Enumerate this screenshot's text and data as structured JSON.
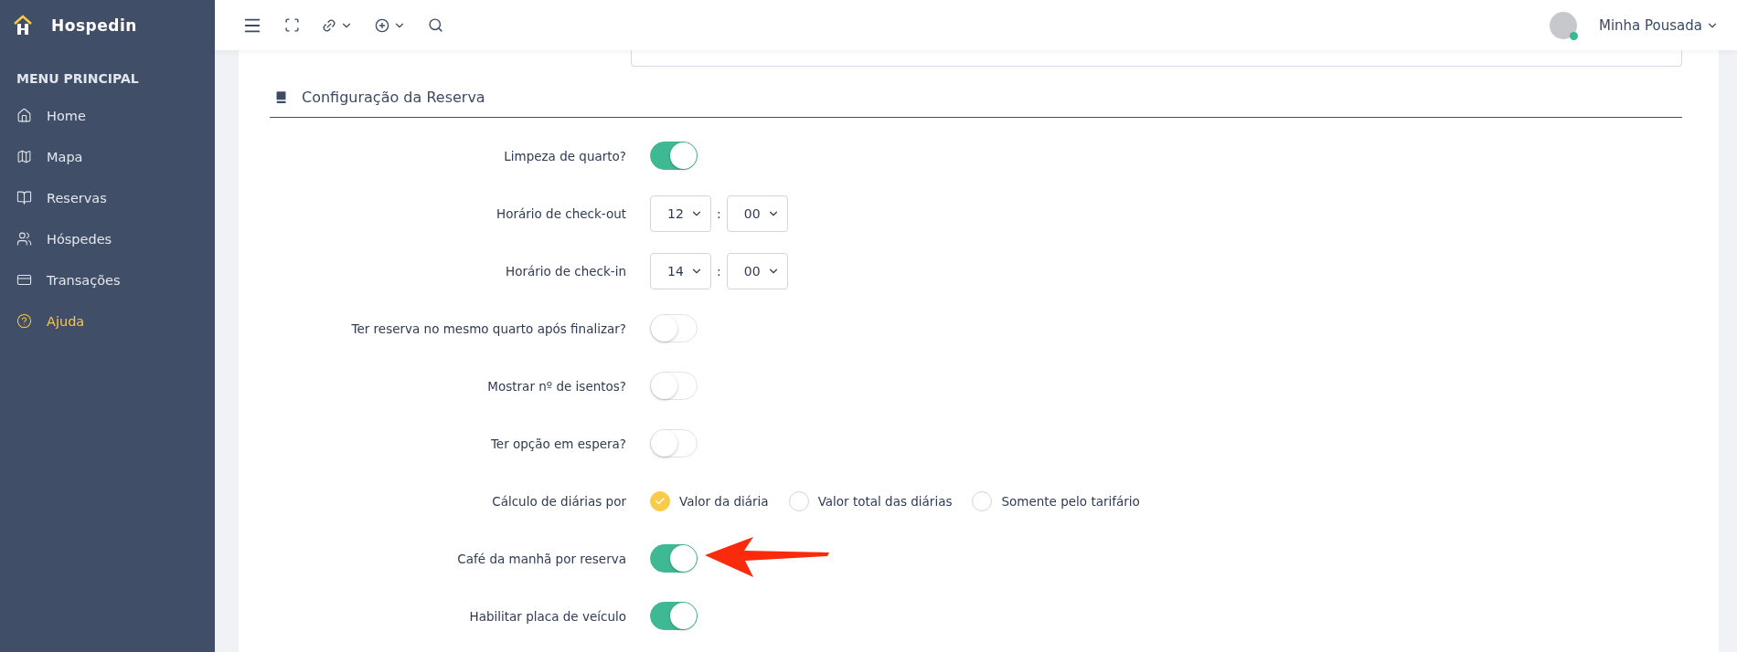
{
  "sidebar": {
    "brand": "Hospedin",
    "section_title": "MENU PRINCIPAL",
    "items": [
      {
        "label": "Home",
        "selected": false
      },
      {
        "label": "Mapa",
        "selected": false
      },
      {
        "label": "Reservas",
        "selected": false
      },
      {
        "label": "Hóspedes",
        "selected": false
      },
      {
        "label": "Transações",
        "selected": false
      },
      {
        "label": "Ajuda",
        "selected": true
      }
    ]
  },
  "topbar": {
    "user_name": "Minha Pousada",
    "user_online": true
  },
  "section": {
    "title": "Configuração da Reserva",
    "rows": [
      {
        "kind": "toggle",
        "label": "Limpeza de quarto?",
        "on": true,
        "highlighted": false
      },
      {
        "kind": "time",
        "label": "Horário de check-out",
        "hour": "12",
        "separator": ":",
        "minute": "00"
      },
      {
        "kind": "time",
        "label": "Horário de check-in",
        "hour": "14",
        "separator": ":",
        "minute": "00"
      },
      {
        "kind": "toggle",
        "label": "Ter reserva no mesmo quarto após finalizar?",
        "on": false,
        "highlighted": false
      },
      {
        "kind": "toggle",
        "label": "Mostrar nº de isentos?",
        "on": false,
        "highlighted": false
      },
      {
        "kind": "toggle",
        "label": "Ter opção em espera?",
        "on": false,
        "highlighted": false
      },
      {
        "kind": "radio",
        "label": "Cálculo de diárias por",
        "options": [
          {
            "label": "Valor da diária",
            "selected": true
          },
          {
            "label": "Valor total das diárias",
            "selected": false
          },
          {
            "label": "Somente pelo tarifário",
            "selected": false
          }
        ]
      },
      {
        "kind": "toggle",
        "label": "Café da manhã por reserva",
        "on": true,
        "highlighted": true
      },
      {
        "kind": "toggle",
        "label": "Habilitar placa de veículo",
        "on": true,
        "highlighted": false
      }
    ]
  }
}
